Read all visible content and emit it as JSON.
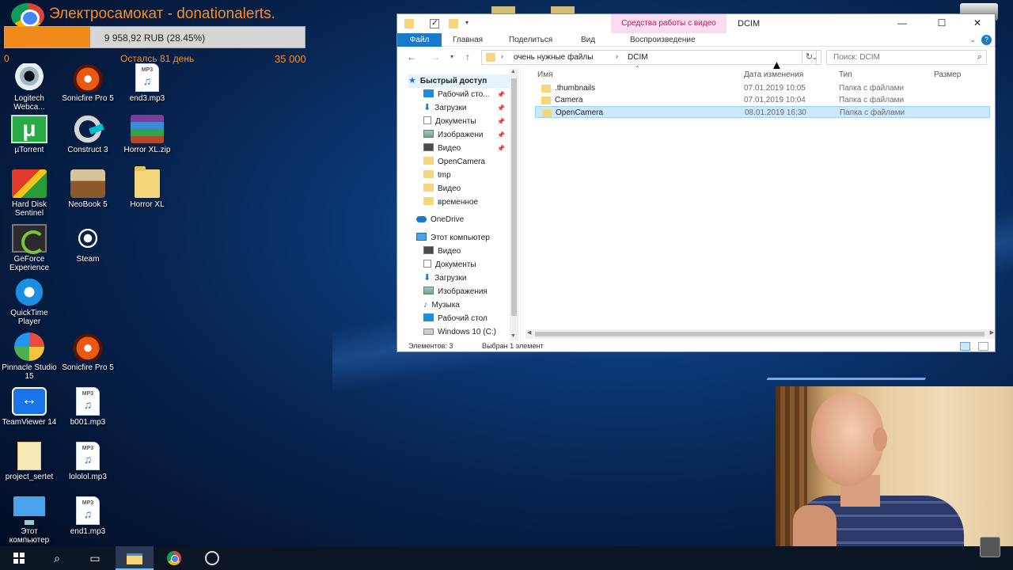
{
  "donation": {
    "title": "Электросамокат - donationalerts.",
    "progress_text": "9 958,92 RUB (28.45%)",
    "progress_fraction": 0.2845,
    "min_label": "0",
    "remaining_label": "Осталсь 81 день",
    "max_label": "35 000",
    "accent_color": "#f28a1a"
  },
  "desktop_icons": [
    {
      "label": "Logitech Webca...",
      "icon": "logitech-webcam-icon"
    },
    {
      "label": "Sonicfire Pro 5",
      "icon": "sonicfire-icon"
    },
    {
      "label": "end3.mp3",
      "icon": "mp3-file-icon"
    },
    {
      "label": "µTorrent",
      "icon": "utorrent-icon"
    },
    {
      "label": "Construct 3",
      "icon": "construct-icon"
    },
    {
      "label": "Horror XL.zip",
      "icon": "winrar-archive-icon"
    },
    {
      "label": "Hard Disk Sentinel",
      "icon": "hard-disk-sentinel-icon"
    },
    {
      "label": "NeoBook 5",
      "icon": "neobook-icon"
    },
    {
      "label": "Horror XL",
      "icon": "folder-icon"
    },
    {
      "label": "GeForce Experience",
      "icon": "geforce-icon"
    },
    {
      "label": "Steam",
      "icon": "steam-icon"
    },
    {
      "label": "QuickTime Player",
      "icon": "quicktime-icon"
    },
    {
      "label": "Pinnacle Studio 15",
      "icon": "pinnacle-icon"
    },
    {
      "label": "Sonicfire Pro 5",
      "icon": "sonicfire-icon"
    },
    {
      "label": "TeamViewer 14",
      "icon": "teamviewer-icon"
    },
    {
      "label": "b001.mp3",
      "icon": "mp3-file-icon"
    },
    {
      "label": "project_sertet",
      "icon": "zip-folder-icon"
    },
    {
      "label": "lololol.mp3",
      "icon": "mp3-file-icon"
    },
    {
      "label": "Этот компьютер",
      "icon": "this-pc-icon"
    },
    {
      "label": "end1.mp3",
      "icon": "mp3-file-icon"
    }
  ],
  "explorer": {
    "window_title": "DCIM",
    "context_tab": "Средства работы с видео",
    "ribbon_tabs": [
      "Файл",
      "Главная",
      "Поделиться",
      "Вид",
      "Воспроизведение"
    ],
    "address": {
      "segments": [
        "очень нужные файлы",
        "DCIM"
      ]
    },
    "search_placeholder": "Поиск: DCIM",
    "nav": {
      "quick_access": "Быстрый доступ",
      "quick_items": [
        "Рабочий сто...",
        "Загрузки",
        "Документы",
        "Изображени",
        "Видео",
        "OpenCamera",
        "tmp",
        "Видео",
        "временное"
      ],
      "onedrive": "OneDrive",
      "this_pc": "Этот компьютер",
      "pc_items": [
        "Видео",
        "Документы",
        "Загрузки",
        "Изображения",
        "Музыка",
        "Рабочий стол",
        "Windows 10 (C:)"
      ]
    },
    "columns": {
      "name": "Имя",
      "date": "Дата изменения",
      "type": "Тип",
      "size": "Размер"
    },
    "files": [
      {
        "name": ".thumbnails",
        "date": "07.01.2019 10:05",
        "type": "Папка с файлами"
      },
      {
        "name": "Camera",
        "date": "07.01.2019 10:04",
        "type": "Папка с файлами"
      },
      {
        "name": "OpenCamera",
        "date": "08.01.2019 16:30",
        "type": "Папка с файлами"
      }
    ],
    "status": {
      "count": "Элементов: 3",
      "selected": "Выбран 1 элемент"
    },
    "accent_color": "#1979ca"
  }
}
